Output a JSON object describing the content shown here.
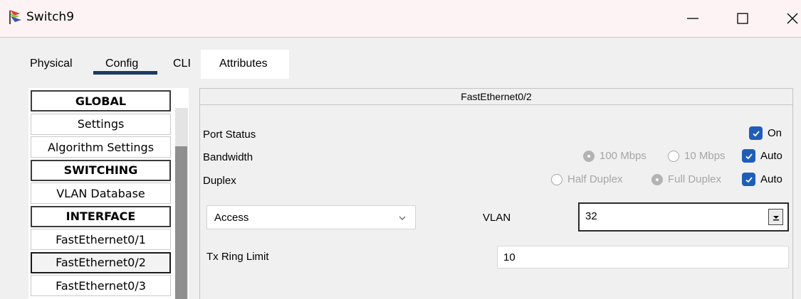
{
  "window": {
    "title": "Switch9",
    "icon": "switch-device-icon"
  },
  "tabs": [
    {
      "label": "Physical",
      "active": false
    },
    {
      "label": "Config",
      "active": true
    },
    {
      "label": "CLI",
      "active": false
    },
    {
      "label": "Attributes",
      "active": false
    }
  ],
  "sidebar": {
    "items": [
      {
        "label": "GLOBAL",
        "type": "header"
      },
      {
        "label": "Settings",
        "type": "item"
      },
      {
        "label": "Algorithm Settings",
        "type": "item"
      },
      {
        "label": "SWITCHING",
        "type": "header"
      },
      {
        "label": "VLAN Database",
        "type": "item"
      },
      {
        "label": "INTERFACE",
        "type": "header"
      },
      {
        "label": "FastEthernet0/1",
        "type": "item"
      },
      {
        "label": "FastEthernet0/2",
        "type": "item",
        "selected": true
      },
      {
        "label": "FastEthernet0/3",
        "type": "item"
      }
    ]
  },
  "port": {
    "name": "FastEthernet0/2",
    "status": {
      "label": "Port Status",
      "on_label": "On",
      "on_checked": true
    },
    "bandwidth": {
      "label": "Bandwidth",
      "options": [
        "100 Mbps",
        "10 Mbps"
      ],
      "auto_label": "Auto",
      "auto_checked": true
    },
    "duplex": {
      "label": "Duplex",
      "options": [
        "Half Duplex",
        "Full Duplex"
      ],
      "auto_label": "Auto",
      "auto_checked": true
    },
    "mode": {
      "value": "Access"
    },
    "vlan": {
      "label": "VLAN",
      "value": "32"
    },
    "tx_ring_limit": {
      "label": "Tx Ring Limit",
      "value": "10"
    }
  },
  "colors": {
    "accent": "#1f5eb8",
    "tab_underline": "#1b3a66"
  }
}
